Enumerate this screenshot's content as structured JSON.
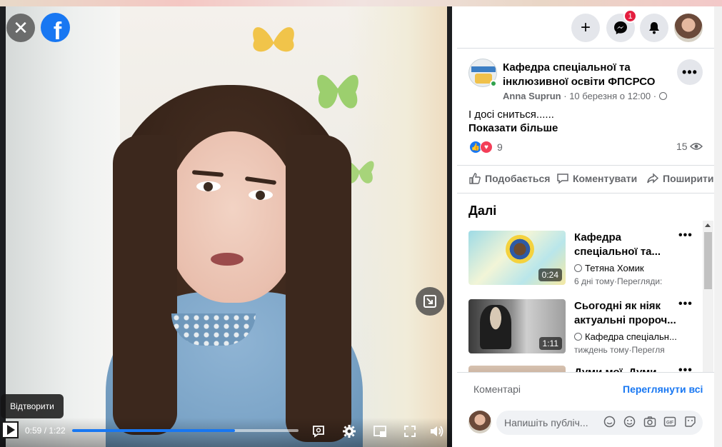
{
  "video": {
    "tooltip": "Відтворити",
    "time_current": "0:59",
    "time_total": "1:22",
    "time_display": "0:59 / 1:22",
    "progress_fraction": 0.72
  },
  "header": {
    "notification_count": "1"
  },
  "post": {
    "page_name": "Кафедра спеціальної та інклюзивної освіти ФПСРСО",
    "author": "Anna Suprun",
    "date": "10 березня о 12:00",
    "text": "І досі сниться......",
    "show_more": "Показати більше",
    "reaction_count": "9",
    "view_count": "15"
  },
  "actions": {
    "like": "Подобається",
    "comment": "Коментувати",
    "share": "Поширити"
  },
  "next": {
    "title": "Далі",
    "items": [
      {
        "title": "Кафедра спеціальної та...",
        "author": "Тетяна Хомик",
        "meta": "6 дні тому·Перегляди:",
        "duration": "0:24"
      },
      {
        "title": "Сьогодні як ніяк актуальні пророч...",
        "author": "Кафедра спеціальн...",
        "meta": "тиждень тому·Перегля",
        "duration": "1:11"
      },
      {
        "title": "Думи мої. Думи",
        "author": "",
        "meta": "",
        "duration": ""
      }
    ]
  },
  "comments": {
    "label": "Коментарі",
    "view_all": "Переглянути всі",
    "placeholder": "Напишіть публіч..."
  },
  "icons": {
    "close": "close-icon",
    "facebook": "facebook-logo",
    "plus": "plus-icon",
    "messenger": "messenger-icon",
    "bell": "bell-icon",
    "gear": "gear-icon",
    "fullscreen": "fullscreen-icon",
    "volume": "volume-icon"
  },
  "colors": {
    "accent": "#1877f2",
    "badge": "#e41e3f",
    "love": "#f33e58"
  }
}
